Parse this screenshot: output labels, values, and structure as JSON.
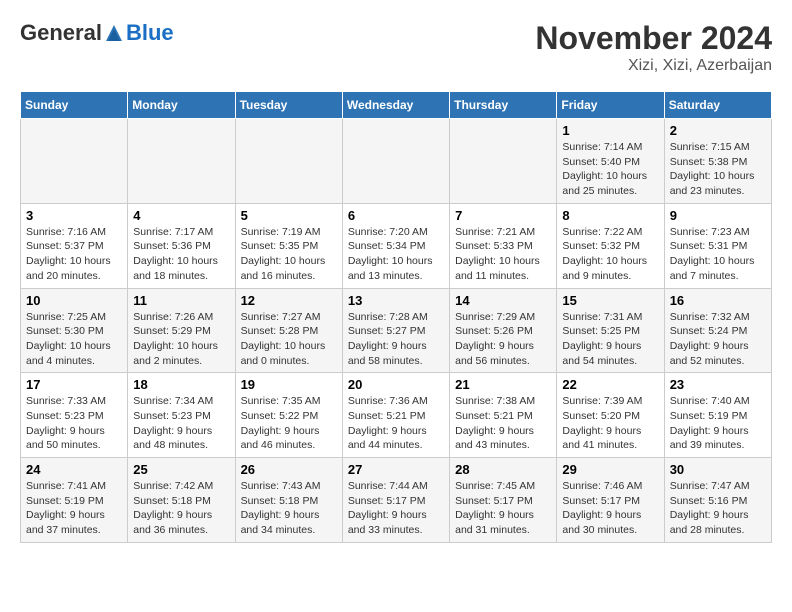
{
  "logo": {
    "general": "General",
    "blue": "Blue"
  },
  "title": "November 2024",
  "subtitle": "Xizi, Xizi, Azerbaijan",
  "days_of_week": [
    "Sunday",
    "Monday",
    "Tuesday",
    "Wednesday",
    "Thursday",
    "Friday",
    "Saturday"
  ],
  "weeks": [
    [
      {
        "day": "",
        "info": ""
      },
      {
        "day": "",
        "info": ""
      },
      {
        "day": "",
        "info": ""
      },
      {
        "day": "",
        "info": ""
      },
      {
        "day": "",
        "info": ""
      },
      {
        "day": "1",
        "info": "Sunrise: 7:14 AM\nSunset: 5:40 PM\nDaylight: 10 hours and 25 minutes."
      },
      {
        "day": "2",
        "info": "Sunrise: 7:15 AM\nSunset: 5:38 PM\nDaylight: 10 hours and 23 minutes."
      }
    ],
    [
      {
        "day": "3",
        "info": "Sunrise: 7:16 AM\nSunset: 5:37 PM\nDaylight: 10 hours and 20 minutes."
      },
      {
        "day": "4",
        "info": "Sunrise: 7:17 AM\nSunset: 5:36 PM\nDaylight: 10 hours and 18 minutes."
      },
      {
        "day": "5",
        "info": "Sunrise: 7:19 AM\nSunset: 5:35 PM\nDaylight: 10 hours and 16 minutes."
      },
      {
        "day": "6",
        "info": "Sunrise: 7:20 AM\nSunset: 5:34 PM\nDaylight: 10 hours and 13 minutes."
      },
      {
        "day": "7",
        "info": "Sunrise: 7:21 AM\nSunset: 5:33 PM\nDaylight: 10 hours and 11 minutes."
      },
      {
        "day": "8",
        "info": "Sunrise: 7:22 AM\nSunset: 5:32 PM\nDaylight: 10 hours and 9 minutes."
      },
      {
        "day": "9",
        "info": "Sunrise: 7:23 AM\nSunset: 5:31 PM\nDaylight: 10 hours and 7 minutes."
      }
    ],
    [
      {
        "day": "10",
        "info": "Sunrise: 7:25 AM\nSunset: 5:30 PM\nDaylight: 10 hours and 4 minutes."
      },
      {
        "day": "11",
        "info": "Sunrise: 7:26 AM\nSunset: 5:29 PM\nDaylight: 10 hours and 2 minutes."
      },
      {
        "day": "12",
        "info": "Sunrise: 7:27 AM\nSunset: 5:28 PM\nDaylight: 10 hours and 0 minutes."
      },
      {
        "day": "13",
        "info": "Sunrise: 7:28 AM\nSunset: 5:27 PM\nDaylight: 9 hours and 58 minutes."
      },
      {
        "day": "14",
        "info": "Sunrise: 7:29 AM\nSunset: 5:26 PM\nDaylight: 9 hours and 56 minutes."
      },
      {
        "day": "15",
        "info": "Sunrise: 7:31 AM\nSunset: 5:25 PM\nDaylight: 9 hours and 54 minutes."
      },
      {
        "day": "16",
        "info": "Sunrise: 7:32 AM\nSunset: 5:24 PM\nDaylight: 9 hours and 52 minutes."
      }
    ],
    [
      {
        "day": "17",
        "info": "Sunrise: 7:33 AM\nSunset: 5:23 PM\nDaylight: 9 hours and 50 minutes."
      },
      {
        "day": "18",
        "info": "Sunrise: 7:34 AM\nSunset: 5:23 PM\nDaylight: 9 hours and 48 minutes."
      },
      {
        "day": "19",
        "info": "Sunrise: 7:35 AM\nSunset: 5:22 PM\nDaylight: 9 hours and 46 minutes."
      },
      {
        "day": "20",
        "info": "Sunrise: 7:36 AM\nSunset: 5:21 PM\nDaylight: 9 hours and 44 minutes."
      },
      {
        "day": "21",
        "info": "Sunrise: 7:38 AM\nSunset: 5:21 PM\nDaylight: 9 hours and 43 minutes."
      },
      {
        "day": "22",
        "info": "Sunrise: 7:39 AM\nSunset: 5:20 PM\nDaylight: 9 hours and 41 minutes."
      },
      {
        "day": "23",
        "info": "Sunrise: 7:40 AM\nSunset: 5:19 PM\nDaylight: 9 hours and 39 minutes."
      }
    ],
    [
      {
        "day": "24",
        "info": "Sunrise: 7:41 AM\nSunset: 5:19 PM\nDaylight: 9 hours and 37 minutes."
      },
      {
        "day": "25",
        "info": "Sunrise: 7:42 AM\nSunset: 5:18 PM\nDaylight: 9 hours and 36 minutes."
      },
      {
        "day": "26",
        "info": "Sunrise: 7:43 AM\nSunset: 5:18 PM\nDaylight: 9 hours and 34 minutes."
      },
      {
        "day": "27",
        "info": "Sunrise: 7:44 AM\nSunset: 5:17 PM\nDaylight: 9 hours and 33 minutes."
      },
      {
        "day": "28",
        "info": "Sunrise: 7:45 AM\nSunset: 5:17 PM\nDaylight: 9 hours and 31 minutes."
      },
      {
        "day": "29",
        "info": "Sunrise: 7:46 AM\nSunset: 5:17 PM\nDaylight: 9 hours and 30 minutes."
      },
      {
        "day": "30",
        "info": "Sunrise: 7:47 AM\nSunset: 5:16 PM\nDaylight: 9 hours and 28 minutes."
      }
    ]
  ]
}
